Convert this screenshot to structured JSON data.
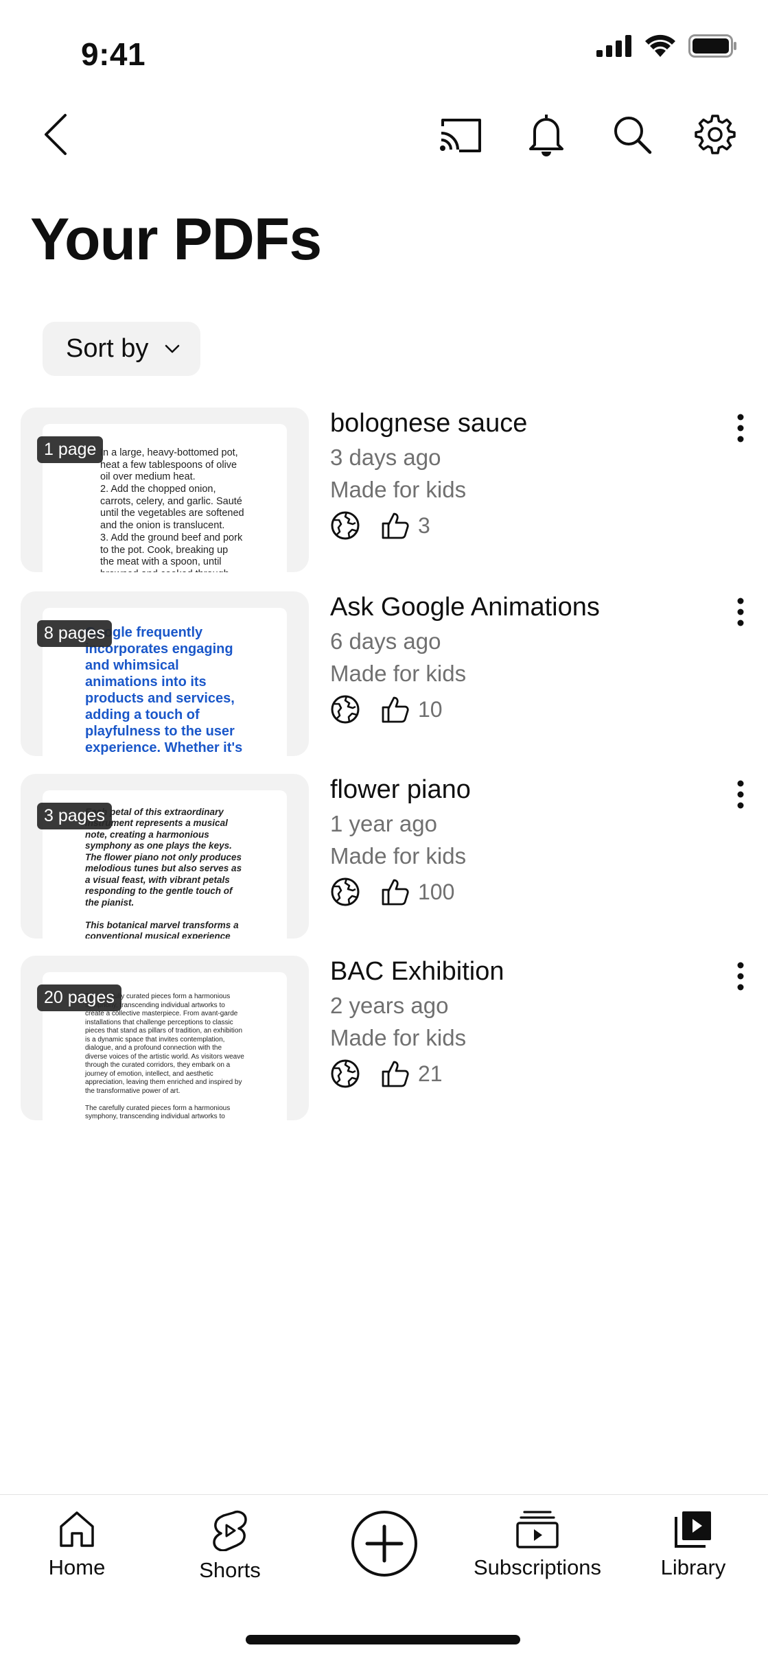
{
  "status": {
    "time": "9:41"
  },
  "header": {
    "title": "Your PDFs",
    "sort_label": "Sort by"
  },
  "items": [
    {
      "title": "bolognese sauce",
      "time": "3 days ago",
      "audience": "Made for kids",
      "likes": "3",
      "pages": "1 page",
      "preview": "In a large, heavy-bottomed pot, heat a few tablespoons of olive oil over medium heat.\n2. Add the chopped onion, carrots, celery, and garlic. Sauté until the vegetables are softened and the onion is translucent.\n3. Add the ground beef and pork to the pot. Cook, breaking up the meat with a spoon, until browned and cooked through."
    },
    {
      "title": "Ask Google Animations",
      "time": "6 days ago",
      "audience": "Made for kids",
      "likes": "10",
      "pages": "8 pages",
      "preview": "Google frequently incorporates engaging and whimsical animations into its products and services, adding a touch of playfulness to the user experience. Whether it's"
    },
    {
      "title": "flower piano",
      "time": "1 year ago",
      "audience": "Made for kids",
      "likes": "100",
      "pages": "3 pages",
      "preview": "Each petal of this extraordinary instrument represents a musical note, creating a harmonious symphony as one plays the keys. The flower piano not only produces melodious tunes but also serves as a visual feast, with vibrant petals responding to the gentle touch of the pianist.\n\nThis botanical marvel transforms a conventional musical experience into a sensorial journey, where the tactile"
    },
    {
      "title": "BAC Exhibition",
      "time": "2 years ago",
      "audience": "Made for kids",
      "likes": "21",
      "pages": "20 pages",
      "preview": "The carefully curated pieces form a harmonious symphony, transcending individual artworks to create a collective masterpiece. From avant-garde installations that challenge perceptions to classic pieces that stand as pillars of tradition, an exhibition is a dynamic space that invites contemplation, dialogue, and a profound connection with the diverse voices of the artistic world. As visitors weave through the curated corridors, they embark on a journey of emotion, intellect, and aesthetic appreciation, leaving them enriched and inspired by the transformative power of art.\n\nThe carefully curated pieces form a harmonious symphony, transcending individual artworks to create a collective masterpiece. From avant-garde installations that"
    }
  ],
  "nav": {
    "home": "Home",
    "shorts": "Shorts",
    "subscriptions": "Subscriptions",
    "library": "Library"
  },
  "colors": {
    "link_blue": "#1a57c9",
    "meta_gray": "#707070"
  }
}
